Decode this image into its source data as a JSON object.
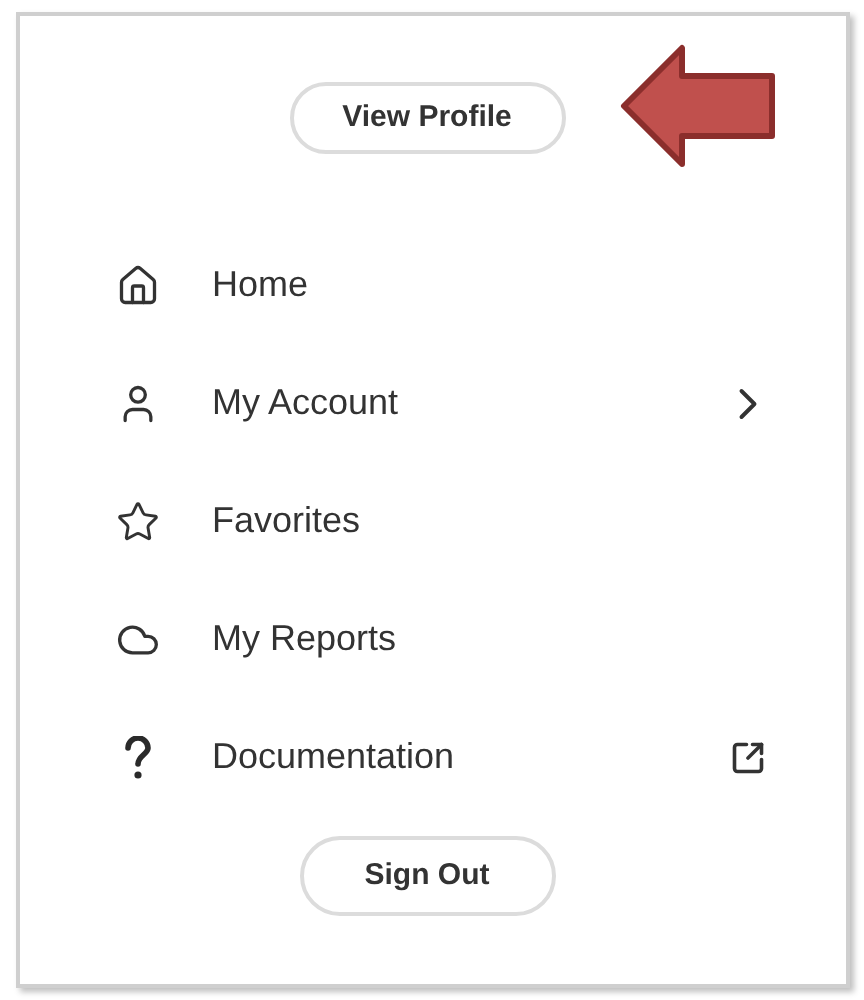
{
  "profile_button": {
    "label": "View Profile"
  },
  "menu": [
    {
      "label": "Home",
      "kind": "plain"
    },
    {
      "label": "My Account",
      "kind": "submenu"
    },
    {
      "label": "Favorites",
      "kind": "plain"
    },
    {
      "label": "My Reports",
      "kind": "plain"
    },
    {
      "label": "Documentation",
      "kind": "external"
    }
  ],
  "sign_out_button": {
    "label": "Sign Out"
  }
}
